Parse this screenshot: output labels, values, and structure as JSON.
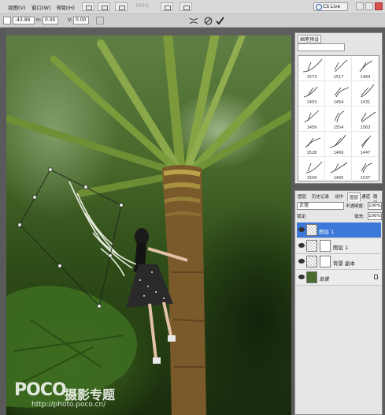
{
  "menu": {
    "items": [
      "视图(V)",
      "窗口(W)",
      "帮助(H)"
    ],
    "zoom": "100%",
    "cs_live": "CS Live"
  },
  "options": {
    "x_value": "-43.89",
    "h_label": "H:",
    "h_value": "0.00",
    "v_label": "V:",
    "v_value": "0.00"
  },
  "watermark": {
    "logo": "POCO",
    "cn": "摄影专题",
    "url": "http://photo.poco.cn/"
  },
  "brush_panel": {
    "tab": "画笔预设",
    "brushes": [
      "1573",
      "1517",
      "1464",
      "1403",
      "1454",
      "1431",
      "1459",
      "1554",
      "1563",
      "1528",
      "1469",
      "1447",
      "1509",
      "1465",
      "1537"
    ]
  },
  "layers_panel": {
    "tabs": [
      "图层",
      "历史记录",
      "动作",
      "图层",
      "通道",
      "路径"
    ],
    "blend_mode": "正常",
    "opacity_label": "不透明度:",
    "opacity": "100%",
    "fill_label": "填充:",
    "fill": "100%",
    "lock_label": "锁定:",
    "layers": [
      "图层 1",
      "图层 1",
      "背景 副本",
      "背景"
    ]
  }
}
